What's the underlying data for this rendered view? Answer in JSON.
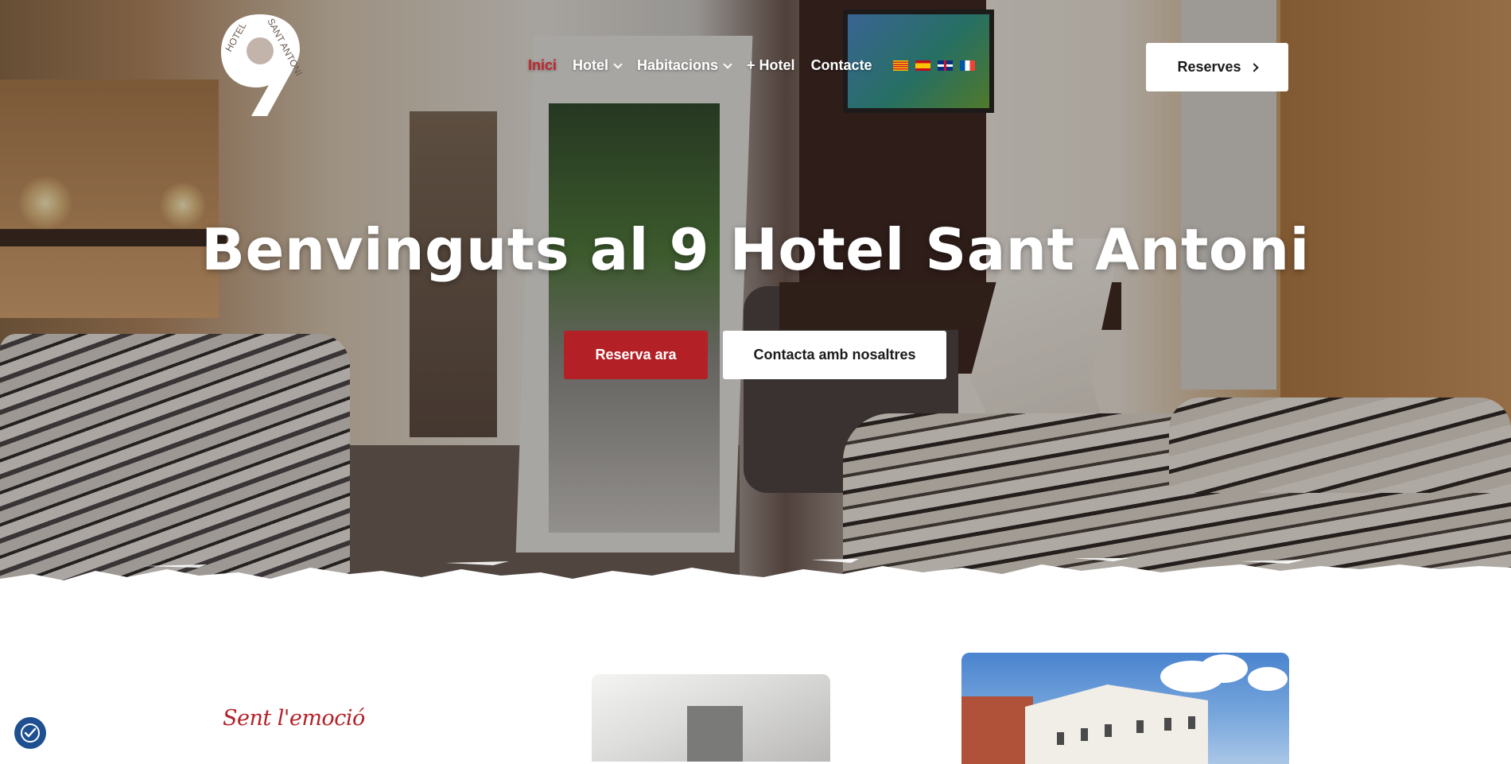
{
  "brand": {
    "logo_digit": "9",
    "logo_text_left": "HOTEL",
    "logo_text_right": "SANT ANTONI"
  },
  "nav": {
    "items": [
      {
        "label": "Inici",
        "active": true,
        "has_dropdown": false
      },
      {
        "label": "Hotel",
        "active": false,
        "has_dropdown": true
      },
      {
        "label": "Habitacions",
        "active": false,
        "has_dropdown": true
      },
      {
        "label": "+ Hotel",
        "active": false,
        "has_dropdown": false
      },
      {
        "label": "Contacte",
        "active": false,
        "has_dropdown": false
      }
    ],
    "languages": [
      "catalan-flag-icon",
      "spanish-flag-icon",
      "uk-flag-icon",
      "french-flag-icon"
    ]
  },
  "header": {
    "reserves_label": "Reserves"
  },
  "hero": {
    "title": "Benvinguts al 9 Hotel Sant Antoni",
    "primary_button": "Reserva ara",
    "secondary_button": "Contacta amb nosaltres"
  },
  "section": {
    "tagline": "Sent l'emoció"
  },
  "colors": {
    "accent": "#b32127",
    "active_nav": "#c0262d",
    "cookie_button": "#1d4f91"
  }
}
